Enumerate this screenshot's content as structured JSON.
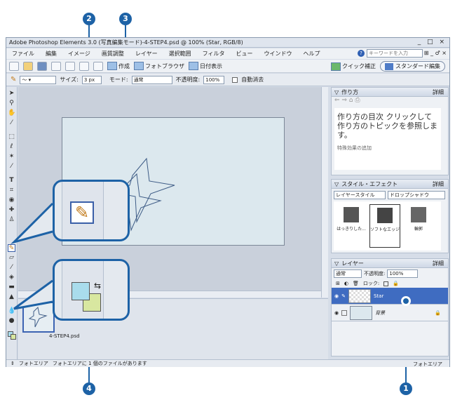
{
  "window": {
    "title": "Adobe Photoshop Elements 3.0 (写真編集モード)-4-STEP4.psd @ 100% (Star, RGB/8)",
    "controls": "_ □ ×"
  },
  "menubar": {
    "items": [
      "ファイル",
      "編集",
      "イメージ",
      "画質調整",
      "レイヤー",
      "選択範囲",
      "フィルタ",
      "ビュー",
      "ウインドウ",
      "ヘルプ"
    ],
    "keyword_placeholder": "キーワードを入力",
    "window_controls": "⊞ _ ♂ ×"
  },
  "toolbar": {
    "create_label": "作成",
    "browser_label": "フォトブラウザ",
    "date_label": "日付表示",
    "quickfix_label": "クイック補正",
    "standard_label": "スタンダード編集"
  },
  "options": {
    "size_label": "サイズ:",
    "size_value": "3 px",
    "mode_label": "モード:",
    "mode_value": "通常",
    "opacity_label": "不透明度:",
    "opacity_value": "100%",
    "auto_erase_label": "自動消去"
  },
  "howto": {
    "title": "作り方",
    "detail": "詳細",
    "text": "作り方の目次 クリックして作り方のトピックを参照します。",
    "link": "特殊効果の追加"
  },
  "styles": {
    "title": "スタイル・エフェクト",
    "detail": "詳細",
    "category": "レイヤースタイル",
    "subcategory": "ドロップシャドウ",
    "items": [
      "はっきりした...",
      "ソフトなエッジ",
      "輪郭"
    ]
  },
  "layers": {
    "title": "レイヤー",
    "detail": "詳細",
    "blend": "通常",
    "opacity_label": "不透明度:",
    "opacity_value": "100%",
    "lock_label": "ロック:",
    "items": [
      "Star",
      "背景"
    ]
  },
  "photobin": {
    "thumb_label": "4-STEP4.psd"
  },
  "status": {
    "left": "フォトエリア",
    "message": "フォトエリアに 1 個のファイルがあります",
    "right": "フォトエリア"
  },
  "callouts": [
    "1",
    "2",
    "3",
    "4"
  ],
  "colors": {
    "accent": "#1d62a6",
    "selected_layer": "#3f6cc1"
  }
}
